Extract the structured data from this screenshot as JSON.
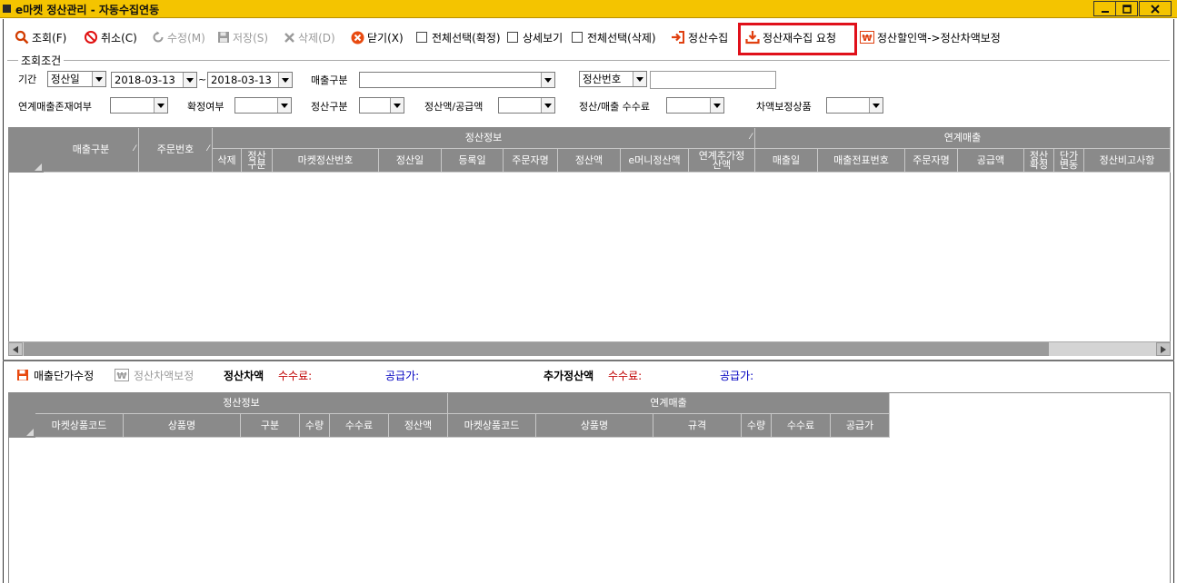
{
  "window": {
    "title": "e마켓 정산관리 - 자동수집연동",
    "controls": {
      "minimize": "minimize-icon",
      "maximize": "maximize-icon",
      "close": "close-icon"
    }
  },
  "toolbar": {
    "search": "조회(F)",
    "cancel": "취소(C)",
    "edit": "수정(M)",
    "save": "저장(S)",
    "delete": "삭제(D)",
    "close": "닫기(X)",
    "select_all_confirm": "전체선택(확정)",
    "detail_view": "상세보기",
    "select_all_delete": "전체선택(삭제)",
    "collect": "정산수집",
    "recollect_request": "정산재수집 요청",
    "discount_adjust": "정산할인액->정산차액보정"
  },
  "search": {
    "legend": "조회조건",
    "period_label": "기간",
    "period_type": "정산일",
    "date_from": "2018-03-13",
    "date_sep": "~",
    "date_to": "2018-03-13",
    "sales_type_label": "매출구분",
    "sales_type_value": "",
    "key_type": "정산번호",
    "key_value": "",
    "linked_exists_label": "연계매출존재여부",
    "confirmed_label": "확정여부",
    "settle_type_label": "정산구분",
    "amount_supply_label": "정산액/공급액",
    "fee_label": "정산/매출 수수료",
    "diff_adjust_label": "차액보정상품"
  },
  "grid1": {
    "sales_type": "매출구분",
    "order_no": "주문번호",
    "group_settle": "정산정보",
    "group_linked": "연계매출",
    "delete": "삭제",
    "settle_type": "정산구분",
    "market_settle_no": "마켓정산번호",
    "settle_date": "정산일",
    "reg_date": "등록일",
    "orderer": "주문자명",
    "settle_amount": "정산액",
    "emoney": "e머니정산액",
    "extra_settle": "연계추가정산액",
    "sales_date": "매출일",
    "sales_slip": "매출전표번호",
    "orderer2": "주문자명",
    "supply": "공급액",
    "settle_confirm": "정산확정",
    "price_change": "단가변동",
    "remarks": "정산비고사항"
  },
  "lower_toolbar": {
    "unit_price_edit": "매출단가수정",
    "diff_adjust": "정산차액보정",
    "settle_diff": "정산차액",
    "fee1": "수수료:",
    "supply1": "공급가:",
    "extra_settle": "추가정산액",
    "fee2": "수수료:",
    "supply2": "공급가:"
  },
  "grid2": {
    "group_settle": "정산정보",
    "group_linked": "연계매출",
    "market_code": "마켓상품코드",
    "product_name": "상품명",
    "type": "구분",
    "qty": "수량",
    "fee": "수수료",
    "settle_amount": "정산액",
    "market_code2": "마켓상품코드",
    "product_name2": "상품명",
    "spec": "규격",
    "qty2": "수량",
    "fee2": "수수료",
    "supply": "공급가"
  },
  "colors": {
    "titlebar": "#f4c400",
    "highlight": "#e0101a",
    "header": "#8a8a8a",
    "fee_label": "#c00000",
    "supply_label": "#0000c0"
  }
}
